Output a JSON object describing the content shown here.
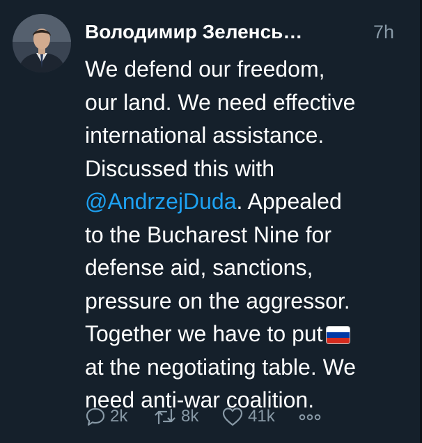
{
  "tweet": {
    "author_name": "Володимир Зеленсь…",
    "timestamp": "7h",
    "text_lines": [
      "We defend our freedom,",
      "our land. We need effective",
      "international assistance.",
      "Discussed this with",
      "@AndrzejDuda",
      ". Appealed",
      "to the Bucharest Nine for",
      "defense aid, sanctions,",
      "pressure on the aggressor.",
      "Together we have to put",
      "at the negotiating table. We",
      "need anti-war coalition."
    ],
    "emoji": "russia-flag",
    "colors": {
      "background": "#15202b",
      "text": "#ffffff",
      "muted": "#8899a6",
      "mention": "#1da1f2"
    }
  },
  "actions": {
    "reply_count": "2k",
    "retweet_count": "8k",
    "like_count": "41k"
  }
}
